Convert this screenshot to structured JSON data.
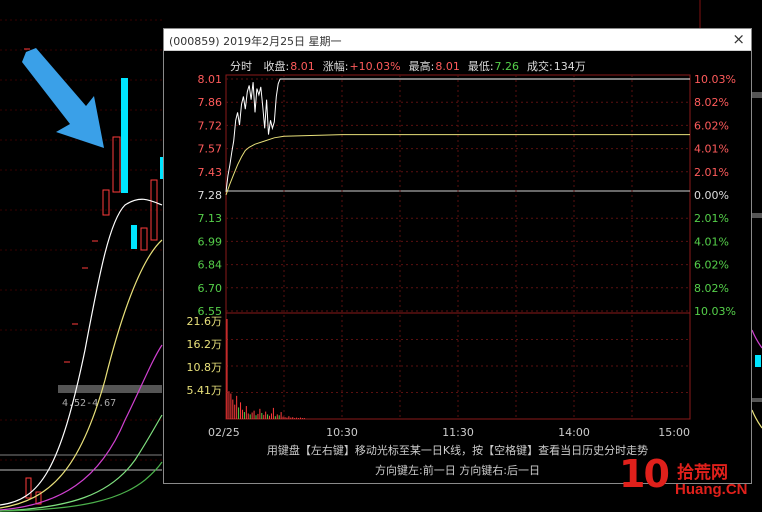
{
  "background": {
    "ma_label": "4.52-4.67"
  },
  "popup": {
    "title": "(000859) 2019年2月25日 星期一",
    "close": "×",
    "info": {
      "mode": "分时",
      "close_label": "收盘:",
      "close_value": "8.01",
      "change_label": "涨幅:",
      "change_value": "+10.03%",
      "high_label": "最高:",
      "high_value": "8.01",
      "low_label": "最低:",
      "low_value": "7.26",
      "volume_label": "成交:",
      "volume_value": "134万"
    },
    "hint_line1": "用键盘【左右键】移动光标至某一日K线，按【空格键】查看当日历史分时走势",
    "hint_line2": "方向键左:前一日    方向键右:后一日"
  },
  "chart_data": {
    "type": "line",
    "title": "",
    "prev_close": 7.28,
    "price_ticks_left": [
      "8.01",
      "7.86",
      "7.72",
      "7.57",
      "7.43",
      "7.28",
      "7.13",
      "6.99",
      "6.84",
      "6.70",
      "6.55"
    ],
    "pct_ticks_right": [
      "10.03%",
      "8.02%",
      "6.02%",
      "4.01%",
      "2.01%",
      "0.00%",
      "2.01%",
      "4.01%",
      "6.02%",
      "8.02%",
      "10.03%"
    ],
    "volume_ticks": [
      "21.6万",
      "16.2万",
      "10.8万",
      "5.41万"
    ],
    "x_ticks": [
      "02/25",
      "10:30",
      "11:30",
      "14:00",
      "15:00"
    ],
    "ylim": [
      6.55,
      8.01
    ],
    "volume_max": 21.6,
    "series": [
      {
        "name": "",
        "color": "#ffffff",
        "x": [
          0,
          1,
          2,
          3,
          4,
          5,
          6,
          7,
          8,
          9,
          10,
          11,
          12,
          13,
          14,
          15,
          16,
          17,
          18,
          19,
          20,
          21,
          22,
          23,
          24,
          25,
          26,
          27,
          28,
          29,
          30,
          240
        ],
        "values": [
          7.3,
          7.4,
          7.47,
          7.55,
          7.62,
          7.75,
          7.8,
          7.72,
          7.85,
          7.9,
          7.82,
          7.93,
          7.97,
          7.88,
          7.99,
          7.8,
          7.95,
          7.91,
          7.96,
          7.84,
          7.7,
          7.88,
          7.66,
          7.75,
          7.7,
          7.74,
          7.9,
          7.98,
          8.01,
          8.01,
          8.01,
          8.01
        ]
      },
      {
        "name": "",
        "color": "#e8e07a",
        "x": [
          0,
          2,
          4,
          6,
          8,
          10,
          12,
          15,
          20,
          25,
          30,
          60,
          120,
          180,
          240
        ],
        "values": [
          7.28,
          7.35,
          7.41,
          7.47,
          7.52,
          7.56,
          7.58,
          7.6,
          7.62,
          7.64,
          7.65,
          7.66,
          7.66,
          7.66,
          7.66
        ]
      }
    ],
    "volume_series": {
      "x": [
        0,
        1,
        2,
        3,
        4,
        5,
        6,
        7,
        8,
        9,
        10,
        11,
        12,
        13,
        14,
        15,
        16,
        17,
        18,
        19,
        20,
        21,
        22,
        23,
        24,
        25,
        26,
        27,
        28,
        29,
        30,
        31,
        32,
        33,
        34,
        35,
        36,
        37,
        38,
        39,
        40
      ],
      "values": [
        21.6,
        6.0,
        5.5,
        4.2,
        3.1,
        5.0,
        2.5,
        3.6,
        2.0,
        1.5,
        2.8,
        1.2,
        1.0,
        1.4,
        1.8,
        0.8,
        1.1,
        2.2,
        1.3,
        0.9,
        1.6,
        1.0,
        0.7,
        1.2,
        2.4,
        0.6,
        1.0,
        0.8,
        1.5,
        0.5,
        0.4,
        0.3,
        0.6,
        0.3,
        0.4,
        0.2,
        0.3,
        0.2,
        0.3,
        0.2,
        0.2
      ],
      "colors": [
        "red",
        "red",
        "red",
        "red",
        "red",
        "red",
        "green",
        "red",
        "red",
        "green",
        "red",
        "red",
        "green",
        "red",
        "red",
        "green",
        "red",
        "red",
        "green",
        "red",
        "red",
        "green",
        "red",
        "red",
        "red",
        "green",
        "red",
        "green",
        "red",
        "red",
        "red",
        "red",
        "red",
        "red",
        "red",
        "red",
        "red",
        "red",
        "red",
        "red",
        "red"
      ]
    }
  },
  "colors": {
    "up": "#ff3b3b",
    "down": "#55d04a",
    "cyan": "#00e5ff",
    "arrow": "#3aa0e8",
    "watermark": "#e0201b"
  },
  "watermark": {
    "ten": "10",
    "cn": "拾荒网",
    "en": "Huang.CN"
  }
}
